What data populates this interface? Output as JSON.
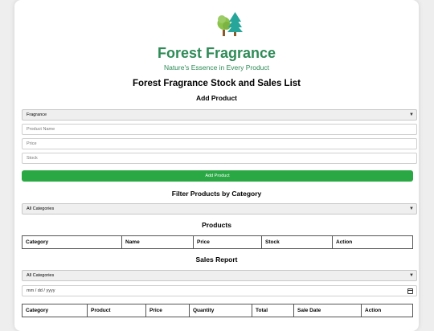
{
  "header": {
    "brand": "Forest Fragrance",
    "tagline": "Nature's Essence in Every Product",
    "page_title": "Forest Fragrance Stock and Sales List"
  },
  "add_product": {
    "title": "Add Product",
    "category_selected": "Fragrance",
    "name_placeholder": "Product Name",
    "price_placeholder": "Price",
    "stock_placeholder": "Stock",
    "button_label": "Add Product"
  },
  "filter": {
    "title": "Filter Products by Category",
    "selected": "All Categories"
  },
  "products": {
    "title": "Products",
    "columns": [
      "Category",
      "Name",
      "Price",
      "Stock",
      "Action"
    ]
  },
  "sales": {
    "title": "Sales Report",
    "category_selected": "All Categories",
    "date_placeholder": "mm / dd / yyyy",
    "columns": [
      "Category",
      "Product",
      "Price",
      "Quantity",
      "Total",
      "Sale Date",
      "Action"
    ]
  },
  "colors": {
    "brand_green": "#2e8b57",
    "button_green": "#2aa844"
  },
  "icons": {
    "logo": "trees-icon",
    "select_arrow": "chevron-down-icon",
    "date_picker": "calendar-icon"
  }
}
